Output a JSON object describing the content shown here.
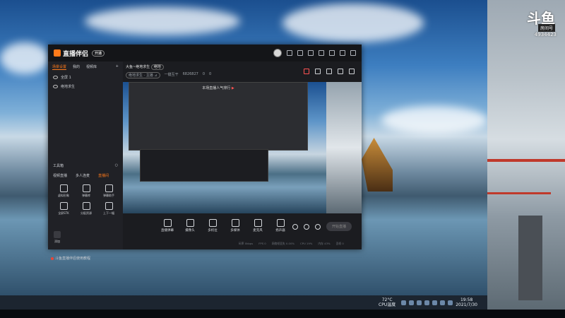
{
  "app": {
    "name": "直播伴侣",
    "vip_label": "开通",
    "left_tabs": [
      "场景设置",
      "我的",
      "视频库"
    ],
    "active_tab_index": 0,
    "scenes": [
      "全屏 1",
      "绝地求生"
    ],
    "tools_header": "工具箱",
    "tool_tabs": [
      "视频直播",
      "多人连麦",
      "直播间"
    ],
    "active_tool_tab_index": 2,
    "tools": [
      "虚拟形象",
      "弹幕库",
      "弹幕助手",
      "全屏STK",
      "分配资源",
      "上下一幅"
    ],
    "add_label": "添加",
    "notice": "斗鱼直播伴侣使用教程"
  },
  "room": {
    "title": "大鱼~绝地求生",
    "tag": "绝地",
    "category": "绝地求生 · 主播 ⊿",
    "followers_label": "一键互干",
    "followers": "6826827",
    "likes": "0",
    "views": "0"
  },
  "preview": {
    "popup_title": "本场直播人气排行",
    "flag": "▶"
  },
  "bottom_tools": [
    "直播弹幕",
    "摄像头",
    "多机位",
    "多媒体",
    "麦克风",
    "扬声器"
  ],
  "start_button": "开始直播",
  "status_items": [
    "码率 0kbps",
    "FPS 0",
    "网络帧丢失 0.00%",
    "CPU 19%",
    "内存 43%",
    "丢帧 0"
  ],
  "taskbar": {
    "weather_temp": "72°C",
    "weather_label": "CPU温度",
    "time": "19:58",
    "date": "2021/7/30"
  },
  "side_stream": {
    "logo": "斗鱼",
    "tag": "房间号",
    "room_id": "4934423"
  }
}
